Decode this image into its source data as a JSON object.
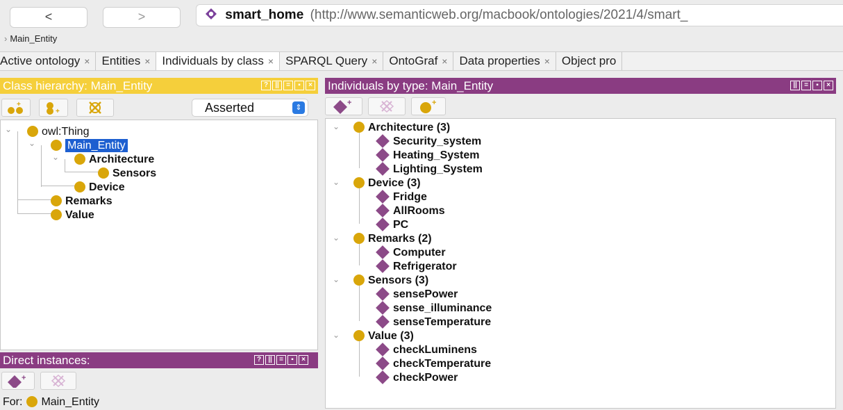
{
  "nav": {
    "back": "<",
    "forward": ">"
  },
  "address": {
    "ontology_name": "smart_home",
    "ontology_iri": "(http://www.semanticweb.org/macbook/ontologies/2021/4/smart_"
  },
  "breadcrumb": "Main_Entity",
  "tabs": [
    {
      "label": "Active ontology"
    },
    {
      "label": "Entities"
    },
    {
      "label": "Individuals by class"
    },
    {
      "label": "SPARQL Query"
    },
    {
      "label": "OntoGraf"
    },
    {
      "label": "Data properties"
    },
    {
      "label": "Object pro"
    }
  ],
  "tab_close": "×",
  "class_hierarchy": {
    "title": "Class hierarchy: Main_Entity",
    "mode": "Asserted",
    "tree": [
      {
        "label": "owl:Thing"
      },
      {
        "label": "Main_Entity"
      },
      {
        "label": "Architecture"
      },
      {
        "label": "Sensors"
      },
      {
        "label": "Device"
      },
      {
        "label": "Remarks"
      },
      {
        "label": "Value"
      }
    ]
  },
  "individuals": {
    "title": "Individuals by type: Main_Entity",
    "groups": [
      {
        "label": "Architecture (3)",
        "items": [
          "Security_system",
          "Heating_System",
          "Lighting_System"
        ]
      },
      {
        "label": "Device (3)",
        "items": [
          "Fridge",
          "AllRooms",
          "PC"
        ]
      },
      {
        "label": "Remarks (2)",
        "items": [
          "Computer",
          "Refrigerator"
        ]
      },
      {
        "label": "Sensors (3)",
        "items": [
          "sensePower",
          "sense_illuminance",
          "senseTemperature"
        ]
      },
      {
        "label": "Value (3)",
        "items": [
          "checkLuminens",
          "checkTemperature",
          "checkPower"
        ]
      }
    ]
  },
  "direct_instances": {
    "title": "Direct instances:",
    "for_label": "For:",
    "for_class": "Main_Entity"
  },
  "colors": {
    "class_accent": "#f5cf3b",
    "individual_accent": "#8a3c82",
    "selection": "#1d5fd0"
  }
}
